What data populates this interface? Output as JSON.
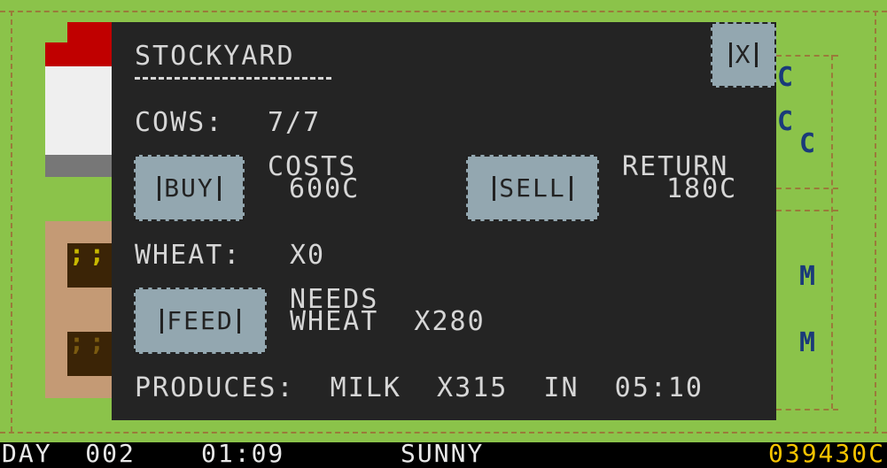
{
  "map": {
    "crop_symbol": ";;",
    "labels": [
      "C",
      "C",
      "C",
      "M",
      "M"
    ]
  },
  "modal": {
    "title": "STOCKYARD",
    "close_label": "X",
    "cows_label": "COWS:",
    "cows_value": "7/7",
    "buy_label": "BUY",
    "costs_label": "COSTS",
    "costs_value": "600C",
    "sell_label": "SELL",
    "return_label": "RETURN",
    "return_value": "180C",
    "wheat_label": "WHEAT:",
    "wheat_value": "X0",
    "feed_label": "FEED",
    "needs_label": "NEEDS",
    "needs_value": "WHEAT  X280",
    "produces_text": "PRODUCES:  MILK  X315  IN  05:10"
  },
  "status": {
    "day": "DAY  002",
    "time": "01:09",
    "weather": "SUNNY",
    "money": "039430C"
  },
  "colors": {
    "grass": "#8bc34a",
    "modal_bg": "#242424",
    "button_bg": "#93a7b0",
    "money": "#f5c400",
    "barn_red": "#c00000"
  }
}
